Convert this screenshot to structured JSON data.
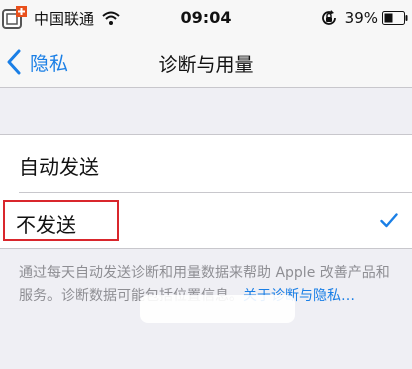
{
  "status_bar": {
    "carrier": "中国联通",
    "time": "09:04",
    "battery_percent": "39%"
  },
  "nav": {
    "back_label": "隐私",
    "title": "诊断与用量"
  },
  "options": [
    {
      "label": "自动发送",
      "selected": false
    },
    {
      "label": "不发送",
      "selected": true
    }
  ],
  "footer": {
    "text": "通过每天自动发送诊断和用量数据来帮助 Apple 改善产品和服务。诊断数据可能包括位置信息。",
    "link": "关于诊断与隐私…"
  },
  "colors": {
    "accent": "#1a7fe6",
    "highlight": "#d9262c",
    "background": "#efeff4"
  }
}
